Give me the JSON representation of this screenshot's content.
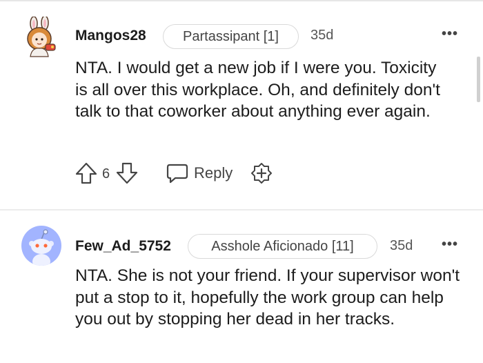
{
  "comments": [
    {
      "username": "Mangos28",
      "flair": "Partassipant [1]",
      "age": "35d",
      "more": "•••",
      "body": "NTA. I would get a new job if I were you. Toxicity is all over this workplace. Oh, and definitely don't talk to that coworker about anything ever again.",
      "vote_count": "6",
      "reply_label": "Reply",
      "avatar_icon": "bunny-avatar-icon"
    },
    {
      "username": "Few_Ad_5752",
      "flair": "Asshole Aficionado [11]",
      "age": "35d",
      "more": "•••",
      "body": "NTA. She is not your friend. If your supervisor won't put a stop to it, hopefully the work group can help you out by stopping her dead in her tracks.",
      "avatar_icon": "snoo-avatar-icon"
    }
  ],
  "colors": {
    "text": "#1c1c1c",
    "muted": "#555555",
    "flair_border": "#d9d9d9",
    "divider": "#ececec",
    "snoo_bg": "#a2b4ff"
  }
}
